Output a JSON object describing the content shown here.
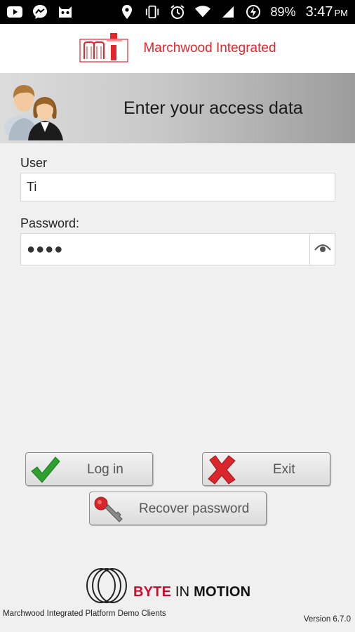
{
  "status_bar": {
    "battery": "89%",
    "time": "3:47",
    "ampm": "PM",
    "icons_left": [
      "youtube-icon",
      "messenger-icon",
      "robot-icon"
    ],
    "icons_right": [
      "location-icon",
      "vibrate-icon",
      "alarm-icon",
      "wifi-icon",
      "signal-icon",
      "battery-saver-icon"
    ]
  },
  "brand": {
    "name": "Marchwood Integrated",
    "logo_icon": "marchwood-logo-icon",
    "color": "#e3262b"
  },
  "title_band": {
    "title": "Enter your access data",
    "illustration": "users-illustration"
  },
  "form": {
    "user_label": "User",
    "user_value": "Ti",
    "password_label": "Password:",
    "password_value": "●●●●",
    "eye_icon": "eye-icon"
  },
  "buttons": {
    "login": "Log in",
    "exit": "Exit",
    "recover": "Recover password"
  },
  "footer": {
    "logo_text": {
      "byte": "BYTE",
      "in": "IN",
      "motion": "MOTION"
    },
    "app_name": "Marchwood Integrated Platform Demo Clients",
    "version": "Version 6.7.0"
  },
  "colors": {
    "accent_red": "#e3262b",
    "check_green": "#2fa02f",
    "exit_red": "#d8262c"
  }
}
